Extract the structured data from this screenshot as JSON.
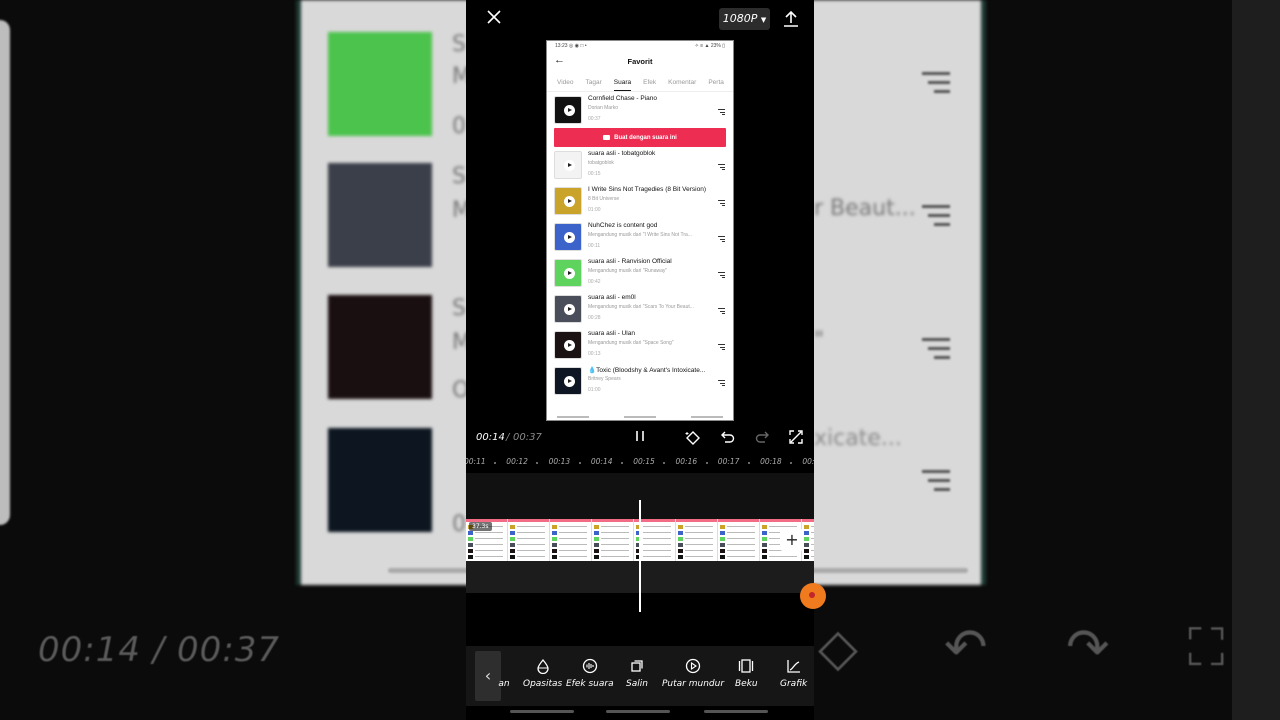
{
  "background": {
    "time_display": "00:14 / 00:37",
    "partial_texts": [
      "S",
      "M",
      "0",
      "S",
      "M",
      "S",
      "M",
      "O",
      "S",
      "M",
      "0",
      "r Beaut...",
      "\"",
      "xicate..."
    ]
  },
  "editor": {
    "topbar": {
      "resolution": "1080P"
    },
    "controls": {
      "current_time": "00:14",
      "separator": "/",
      "total_time": "00:37"
    },
    "ruler_ticks": [
      "00:11",
      "00:12",
      "00:13",
      "00:14",
      "00:15",
      "00:16",
      "00:17",
      "00:18",
      "00:"
    ],
    "clip": {
      "duration_badge": "37.3s"
    },
    "toolbar": {
      "items": [
        {
          "label": "an",
          "icon": "partial-icon"
        },
        {
          "label": "Opasitas",
          "icon": "opacity-drop-icon"
        },
        {
          "label": "Efek suara",
          "icon": "voice-effect-icon"
        },
        {
          "label": "Salin",
          "icon": "copy-icon"
        },
        {
          "label": "Putar mundur",
          "icon": "reverse-play-icon"
        },
        {
          "label": "Beku",
          "icon": "freeze-icon"
        },
        {
          "label": "Grafik",
          "icon": "graph-icon"
        }
      ]
    }
  },
  "preview": {
    "status_left": "13:23 ◎ ◉ □ •",
    "status_right": "✧ ≡ ▲ 23% ▯",
    "title": "Favorit",
    "tabs": [
      "Video",
      "Tagar",
      "Suara",
      "Efek",
      "Komentar",
      "Perta"
    ],
    "active_tab": "Suara",
    "cta_label": "Buat dengan suara ini",
    "items": [
      {
        "name": "Cornfield Chase - Piano",
        "sub": "Dorian Marko",
        "duration": "00:37",
        "thumb_color": "#111111"
      },
      {
        "name": "suara asli - tobatgoblok",
        "sub": "tobatgoblok",
        "duration": "00:15",
        "thumb_color": "#f3f3f3"
      },
      {
        "name": "I Write Sins Not Tragedies (8 Bit Version)",
        "sub": "8 Bit Universe",
        "duration": "01:00",
        "thumb_color": "#c9a32a"
      },
      {
        "name": "NuhChez is content god",
        "sub": "Mengandung musik dari \"I Write Sins Not Tra...",
        "duration": "00:11",
        "thumb_color": "#3b63c9"
      },
      {
        "name": "suara asli - Ranvision Official",
        "sub": "Mengandung musik dari \"Runaway\"",
        "duration": "00:42",
        "thumb_color": "#5ed35e"
      },
      {
        "name": "suara asli - em0l",
        "sub": "Mengandung musik dari \"Scars To Your Beaut...",
        "duration": "00:28",
        "thumb_color": "#4a4e5a"
      },
      {
        "name": "suara asli - Ulan",
        "sub": "Mengandung musik dari \"Space Song\"",
        "duration": "00:13",
        "thumb_color": "#1b1213"
      },
      {
        "name": "💧Toxic (Bloodshy & Avant's Intoxicate...",
        "sub": "Britney Spears",
        "duration": "01:00",
        "thumb_color": "#0d1622"
      }
    ]
  }
}
